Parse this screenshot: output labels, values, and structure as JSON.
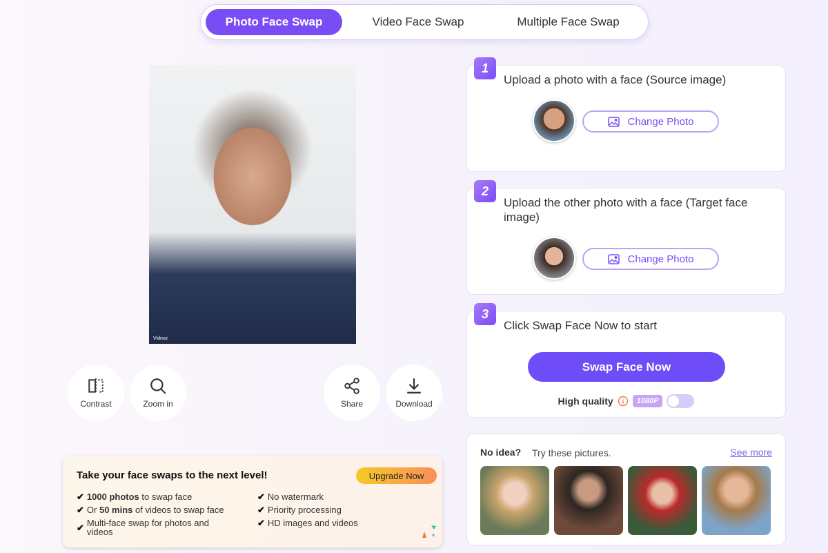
{
  "tabs": [
    {
      "label": "Photo Face Swap",
      "active": true
    },
    {
      "label": "Video Face Swap"
    },
    {
      "label": "Multiple Face Swap"
    }
  ],
  "result": {
    "watermark": "Vidnoz"
  },
  "tools": {
    "contrast": "Contrast",
    "zoom": "Zoom in",
    "share": "Share",
    "download": "Download"
  },
  "steps": [
    {
      "num": "1",
      "title": "Upload a photo with a face (Source image)",
      "button": "Change Photo"
    },
    {
      "num": "2",
      "title": "Upload the other photo with a face (Target face image)",
      "button": "Change Photo"
    },
    {
      "num": "3",
      "title": "Click Swap Face Now to start",
      "button": "Swap Face Now"
    }
  ],
  "quality": {
    "label": "High quality",
    "badge": "1080P",
    "enabled": false
  },
  "ideas": {
    "title": "No idea?",
    "subtitle": "Try these pictures.",
    "link": "See more"
  },
  "promo": {
    "title": "Take your face swaps to the next level!",
    "button": "Upgrade Now",
    "features": [
      {
        "bold": "1000 photos",
        "rest": " to swap face"
      },
      {
        "pre": "Or ",
        "bold": "50 mins",
        "rest": " of videos to swap face"
      },
      {
        "rest": "Multi-face swap for photos and videos"
      },
      {
        "rest": "No watermark"
      },
      {
        "rest": "Priority processing"
      },
      {
        "rest": "HD images and videos"
      }
    ]
  },
  "colors": {
    "accent": "#7a4cf6",
    "button": "#6e4cf8",
    "upgrade_start": "#f5c927",
    "upgrade_end": "#f98f5a"
  }
}
